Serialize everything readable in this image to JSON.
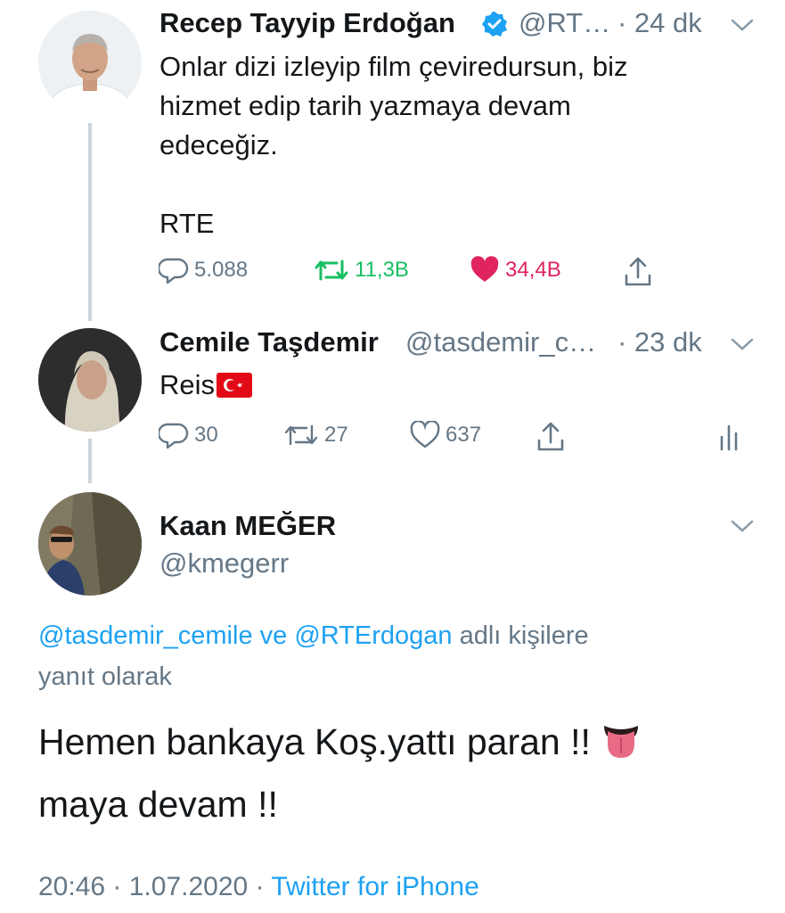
{
  "colors": {
    "accent": "#1da1f2",
    "retweet": "#17bf63",
    "like": "#e0245e",
    "muted": "#657786",
    "text": "#14171a",
    "line": "#ccd6dd"
  },
  "tweet1": {
    "name": "Recep Tayyip Erdoğan",
    "handle": "@RT…",
    "time": "· 24 dk",
    "lines": [
      "Onlar dizi izleyip film çeviredursun, biz",
      "hizmet edip tarih yazmaya devam",
      "edeceğiz."
    ],
    "signature": "RTE",
    "replies": "5.088",
    "retweets": "11,3B",
    "likes": "34,4B"
  },
  "tweet2": {
    "name": "Cemile Taşdemir",
    "handle": "@tasdemir_c…",
    "time": "· 23 dk",
    "text": "Reis",
    "flag": "🇹🇷",
    "replies": "30",
    "retweets": "27",
    "likes": "637"
  },
  "tweet3": {
    "name": "Kaan MEĞER",
    "handle": "@kmegerr",
    "reply_to_user1": "@tasdemir_cemile",
    "reply_to_ve": " ve ",
    "reply_to_user2": "@RTErdogan",
    "reply_to_suffix": " adlı kişilere",
    "reply_to_line2": "yanıt olarak",
    "line1": "Hemen bankaya Koş.yattı paran !!",
    "emoji": "👅",
    "line2": "maya devam !!",
    "timestamp": "20:46 · 1.07.2020 · ",
    "source": "Twitter for iPhone"
  }
}
